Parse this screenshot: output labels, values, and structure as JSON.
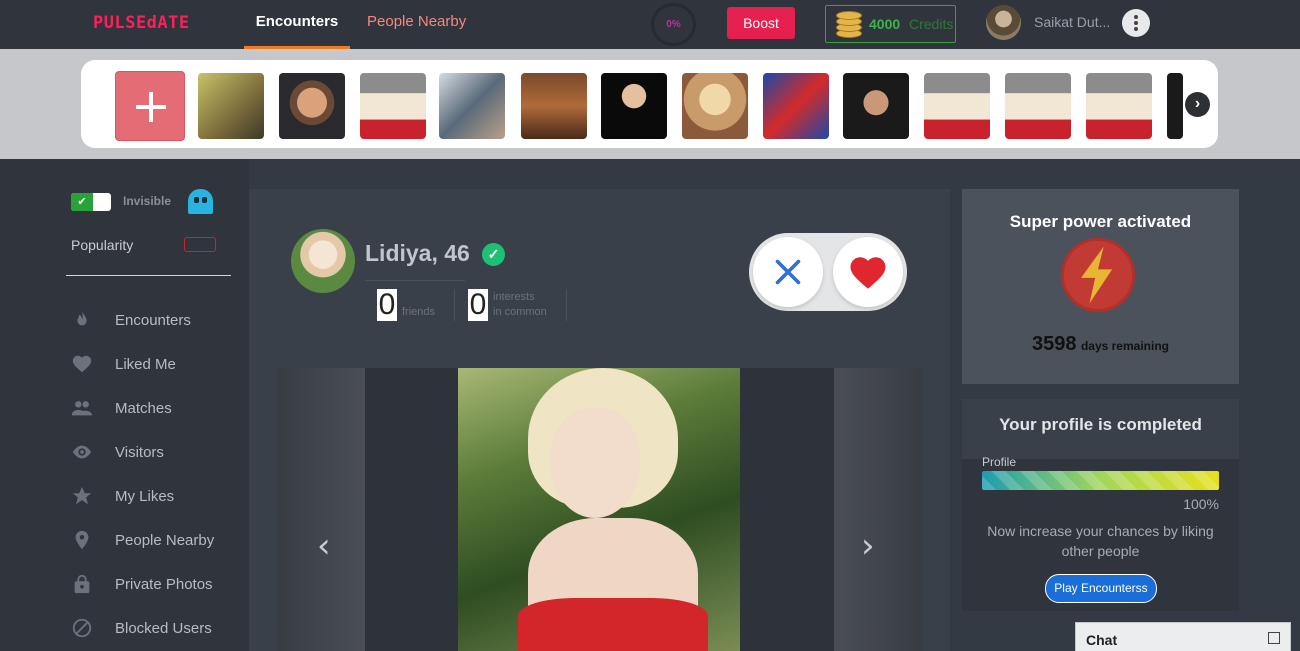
{
  "header": {
    "logo": "PULSEdATE",
    "tabs": [
      {
        "label": "Encounters",
        "active": true
      },
      {
        "label": "People Nearby",
        "active": false
      }
    ],
    "progress_percent": "0%",
    "boost_label": "Boost",
    "credits": {
      "amount": "4000",
      "label": "Credits"
    },
    "user_name": "Saikat Dut..."
  },
  "strip": {
    "add_label": "+",
    "thumbnails": [
      "person-1",
      "person-2",
      "cartoon-man",
      "couple-photo",
      "person-5",
      "person-6",
      "person-7",
      "spiderman",
      "person-9",
      "cartoon-man",
      "cartoon-man",
      "cartoon-man",
      "person-13"
    ]
  },
  "sidebar": {
    "invisible_label": "Invisible",
    "invisible_on": true,
    "popularity_label": "Popularity",
    "menu": [
      {
        "label": "Encounters",
        "icon": "flame-icon"
      },
      {
        "label": "Liked Me",
        "icon": "heart-icon"
      },
      {
        "label": "Matches",
        "icon": "people-icon"
      },
      {
        "label": "Visitors",
        "icon": "eye-icon"
      },
      {
        "label": "My Likes",
        "icon": "star-icon"
      },
      {
        "label": "People Nearby",
        "icon": "location-pin-icon"
      },
      {
        "label": "Private Photos",
        "icon": "lock-icon"
      },
      {
        "label": "Blocked Users",
        "icon": "block-icon"
      }
    ]
  },
  "profile": {
    "name_age": "Lidiya, 46",
    "friends_count": "0",
    "friends_label": "friends",
    "interests_count": "0",
    "interests_label_1": "interests",
    "interests_label_2": "in common"
  },
  "super_power": {
    "title": "Super power activated",
    "days": "3598",
    "days_label": "days remaining"
  },
  "profile_completion": {
    "title": "Your profile is completed",
    "bar_label": "Profile",
    "percent": "100%",
    "percent_value": 1.0,
    "message": "Now increase your chances by liking other people",
    "button_label": "Play Encounterss"
  },
  "chat": {
    "label": "Chat"
  },
  "colors": {
    "accent": "#f07b22",
    "boost": "#e6204e",
    "credits": "#3eb24a",
    "verified": "#1fbf74"
  }
}
